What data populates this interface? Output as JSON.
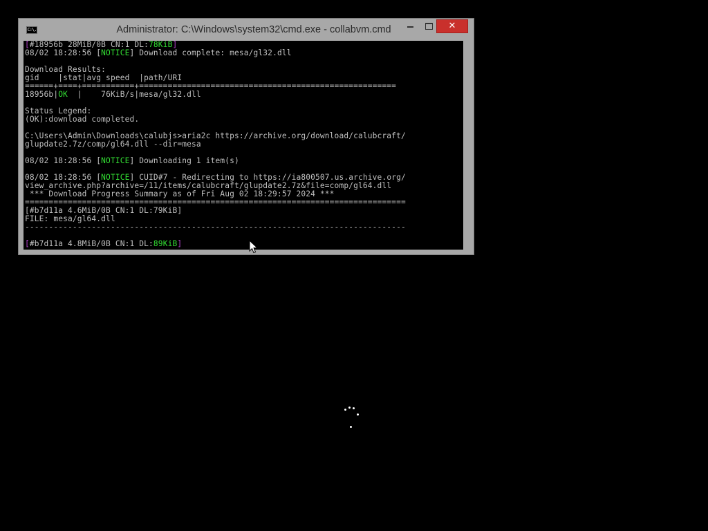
{
  "window": {
    "title": "Administrator: C:\\Windows\\system32\\cmd.exe - collabvm.cmd",
    "icon": "cmd-icon",
    "icon_text": "C:\\.",
    "controls": {
      "minimize": "minimize-icon",
      "maximize": "maximize-icon",
      "close": "close-icon",
      "close_glyph": "✕"
    }
  },
  "console": {
    "lines": [
      [
        {
          "t": "[",
          "c": "magenta"
        },
        {
          "t": "#18956b 28MiB/0B CN:1 DL:"
        },
        {
          "t": "78KiB",
          "c": "green"
        },
        {
          "t": "]",
          "c": "magenta"
        }
      ],
      [
        {
          "t": "08/02 18:28:56 ["
        },
        {
          "t": "NOTICE",
          "c": "green"
        },
        {
          "t": "] Download complete: mesa/gl32.dll"
        }
      ],
      [
        {
          "t": ""
        }
      ],
      [
        {
          "t": "Download Results:"
        }
      ],
      [
        {
          "t": "gid    |stat|avg speed  |path/URI"
        }
      ],
      [
        {
          "t": "======+====+===========+======================================================"
        }
      ],
      [
        {
          "t": "18956b|"
        },
        {
          "t": "OK",
          "c": "green"
        },
        {
          "t": "  |    76KiB/s|mesa/gl32.dll"
        }
      ],
      [
        {
          "t": ""
        }
      ],
      [
        {
          "t": "Status Legend:"
        }
      ],
      [
        {
          "t": "(OK):download completed."
        }
      ],
      [
        {
          "t": ""
        }
      ],
      [
        {
          "t": "C:\\Users\\Admin\\Downloads\\calubjs>aria2c https://archive.org/download/calubcraft/"
        }
      ],
      [
        {
          "t": "glupdate2.7z/comp/gl64.dll --dir=mesa"
        }
      ],
      [
        {
          "t": ""
        }
      ],
      [
        {
          "t": "08/02 18:28:56 ["
        },
        {
          "t": "NOTICE",
          "c": "green"
        },
        {
          "t": "] Downloading 1 item(s)"
        }
      ],
      [
        {
          "t": ""
        }
      ],
      [
        {
          "t": "08/02 18:28:56 ["
        },
        {
          "t": "NOTICE",
          "c": "green"
        },
        {
          "t": "] CUID#7 - Redirecting to https://ia800507.us.archive.org/"
        }
      ],
      [
        {
          "t": "view_archive.php?archive=/11/items/calubcraft/glupdate2.7z&file=comp/gl64.dll"
        }
      ],
      [
        {
          "t": " *** Download Progress Summary as of Fri Aug 02 18:29:57 2024 ***"
        }
      ],
      [
        {
          "t": "================================================================================"
        }
      ],
      [
        {
          "t": "[#b7d11a 4.6MiB/0B CN:1 DL:79KiB]"
        }
      ],
      [
        {
          "t": "FILE: mesa/gl64.dll"
        }
      ],
      [
        {
          "t": "--------------------------------------------------------------------------------"
        }
      ],
      [
        {
          "t": ""
        }
      ],
      [
        {
          "t": "[",
          "c": "magenta"
        },
        {
          "t": "#b7d11a 4.8MiB/0B CN:1 DL:"
        },
        {
          "t": "89KiB",
          "c": "green"
        },
        {
          "t": "]",
          "c": "magenta"
        }
      ]
    ]
  },
  "desktop": {
    "cursor": "arrow-cursor-icon",
    "spinner": "loading-spinner-icon"
  },
  "colors": {
    "green": "#33e033",
    "magenta": "#b040c8",
    "text": "#c0c0c0",
    "close": "#c9302c"
  }
}
